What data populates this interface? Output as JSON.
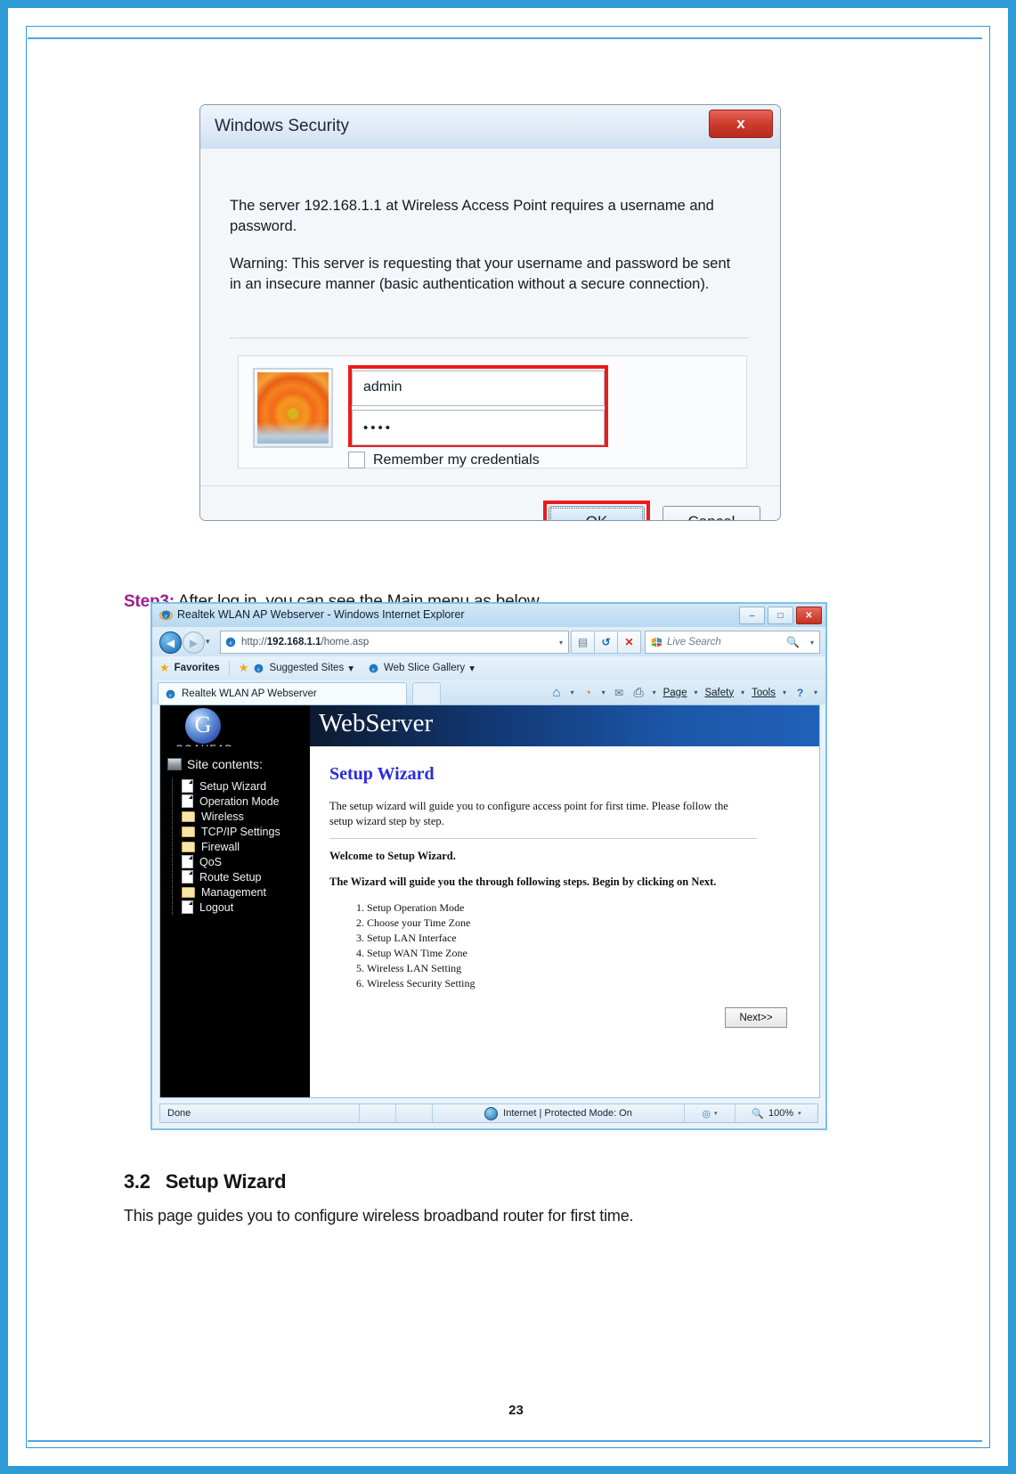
{
  "document": {
    "page_number": "23",
    "step3_key": "Step3:",
    "step3_text": " After log in, you can see the Main menu as below.",
    "section_number": "3.2",
    "section_title": "Setup Wizard",
    "section_body": "This page guides you to configure wireless broadband router for first time.",
    "accent_magenta": "#9b1f8e",
    "accent_blue": "#2e9bd6"
  },
  "security_dialog": {
    "title": "Windows Security",
    "close_label": "x",
    "message_line1": "The server 192.168.1.1 at Wireless Access Point requires a username and password.",
    "message_line2": "Warning: This server is requesting that your username and password be sent in an insecure manner (basic authentication without a secure connection).",
    "username_value": "admin",
    "password_value": "••••",
    "remember_label": "Remember my credentials",
    "ok_label": "OK",
    "cancel_label": "Cancel",
    "highlight_color": "#ee1b1b"
  },
  "browser": {
    "window_title": "Realtek WLAN AP Webserver - Windows Internet Explorer",
    "minimize_label": "–",
    "maximize_label": "□",
    "close_label": "✕",
    "back_label": "◀",
    "forward_label": "▶",
    "recent_caret": "▾",
    "address_prefix": "http://",
    "address_host": "192.168.1.1",
    "address_path": "/home.asp",
    "address_caret": "▾",
    "compat_label": "▤",
    "refresh_label": "↺",
    "stop_label": "✕",
    "search_placeholder": "Live Search",
    "search_icon_label": "🔍",
    "favorites_label": "Favorites",
    "suggested_sites_label": "Suggested Sites",
    "web_slice_label": "Web Slice Gallery",
    "dropdown_caret": "▾",
    "tab_title": "Realtek WLAN AP Webserver",
    "command_bar": {
      "home_icon": "⌂",
      "feeds_icon": "◔",
      "mail_icon": "✉",
      "print_icon": "⎙",
      "page_label": "Page",
      "safety_label": "Safety",
      "tools_label": "Tools",
      "help_label": "?"
    },
    "status_bar": {
      "status_text": "Done",
      "zone_text": "Internet | Protected Mode: On",
      "zoom_level": "100%",
      "zoom_caret": "▾"
    }
  },
  "webserver": {
    "brand": "GOAHEAD",
    "logo_glyph": "G",
    "header_title": "WebServer",
    "site_contents_label": "Site contents:",
    "menu": [
      {
        "label": "Setup Wizard",
        "icon": "document-icon"
      },
      {
        "label": "Operation Mode",
        "icon": "document-icon"
      },
      {
        "label": "Wireless",
        "icon": "folder-icon"
      },
      {
        "label": "TCP/IP Settings",
        "icon": "folder-icon"
      },
      {
        "label": "Firewall",
        "icon": "folder-icon"
      },
      {
        "label": "QoS",
        "icon": "document-icon"
      },
      {
        "label": "Route Setup",
        "icon": "document-icon"
      },
      {
        "label": "Management",
        "icon": "folder-icon"
      },
      {
        "label": "Logout",
        "icon": "document-icon"
      }
    ],
    "content": {
      "heading": "Setup Wizard",
      "intro": "The setup wizard will guide you to configure access point for first time. Please follow the setup wizard step by step.",
      "welcome": "Welcome to Setup Wizard.",
      "guide": "The Wizard will guide you the through following steps. Begin by clicking on Next.",
      "steps": [
        "Setup Operation Mode",
        "Choose your Time Zone",
        "Setup LAN Interface",
        "Setup WAN Time Zone",
        "Wireless LAN Setting",
        "Wireless Security Setting"
      ],
      "next_label": "Next>>"
    }
  }
}
